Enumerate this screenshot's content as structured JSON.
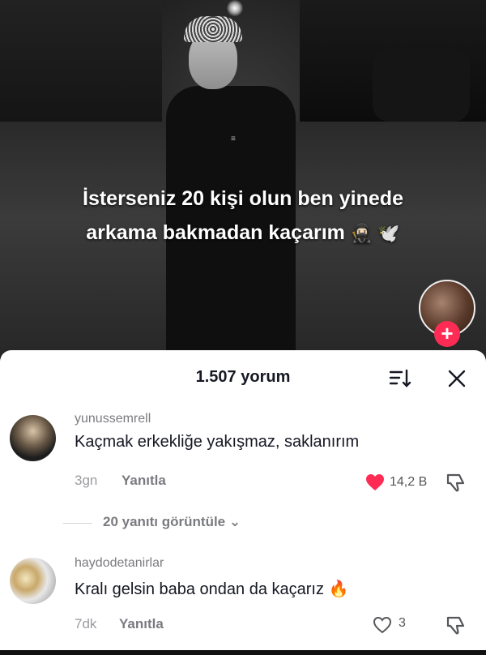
{
  "video": {
    "caption_line1": "İsterseniz 20 kişi olun ben yinede",
    "caption_line2": "arkama bakmadan kaçarım",
    "caption_emoji": "🥷🏻 🕊️",
    "brand_mark": "≡",
    "add_button_label": "+",
    "accent_color": "#fe2c55"
  },
  "comments_panel": {
    "title": "1.507 yorum",
    "sort_icon": "sort-icon",
    "close_icon": "close-icon",
    "comments": [
      {
        "username": "yunussemrell",
        "text": "Kaçmak erkekliğe yakışmaz, saklanırım",
        "time": "3gn",
        "reply_label": "Yanıtla",
        "likes": "14,2 B",
        "liked": true,
        "view_replies": "20 yanıtı görüntüle ⌄"
      },
      {
        "username": "haydodetanirlar",
        "text": "Kralı gelsin baba ondan da kaçarız 🔥",
        "time": "7dk",
        "reply_label": "Yanıtla",
        "likes": "3",
        "liked": false
      }
    ]
  }
}
